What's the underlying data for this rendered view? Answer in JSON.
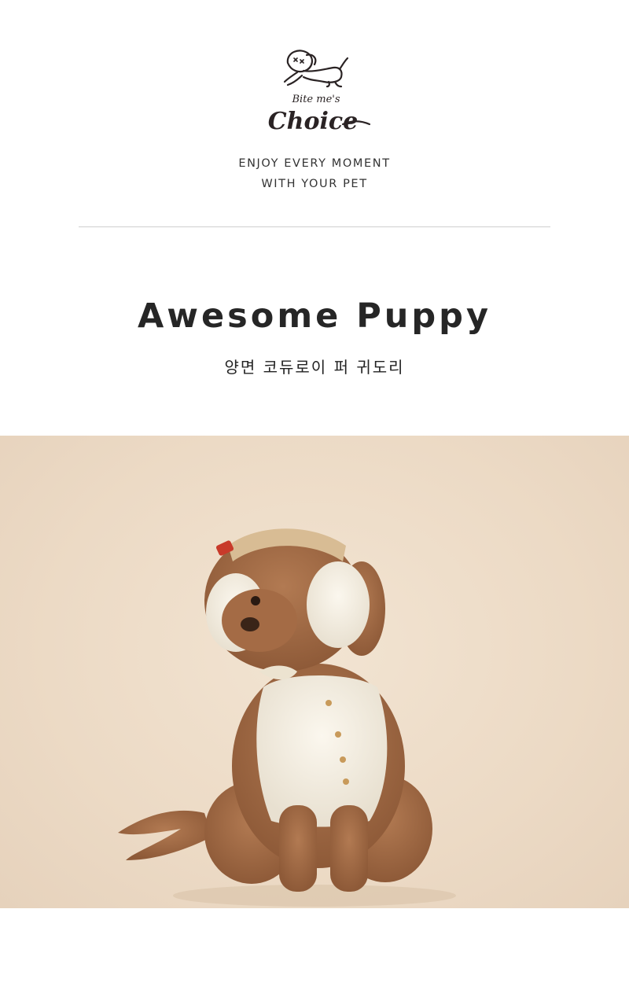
{
  "brand": {
    "logo_small": "Bite me's",
    "logo_large": "Choice"
  },
  "tagline": {
    "line1": "ENJOY EVERY MOMENT",
    "line2": "WITH YOUR PET"
  },
  "hero": {
    "title": "Awesome Puppy",
    "subtitle": "양면 코듀로이 퍼 귀도리"
  },
  "photo": {
    "subject": "dog-icon",
    "background_color": "#ecdac5"
  }
}
